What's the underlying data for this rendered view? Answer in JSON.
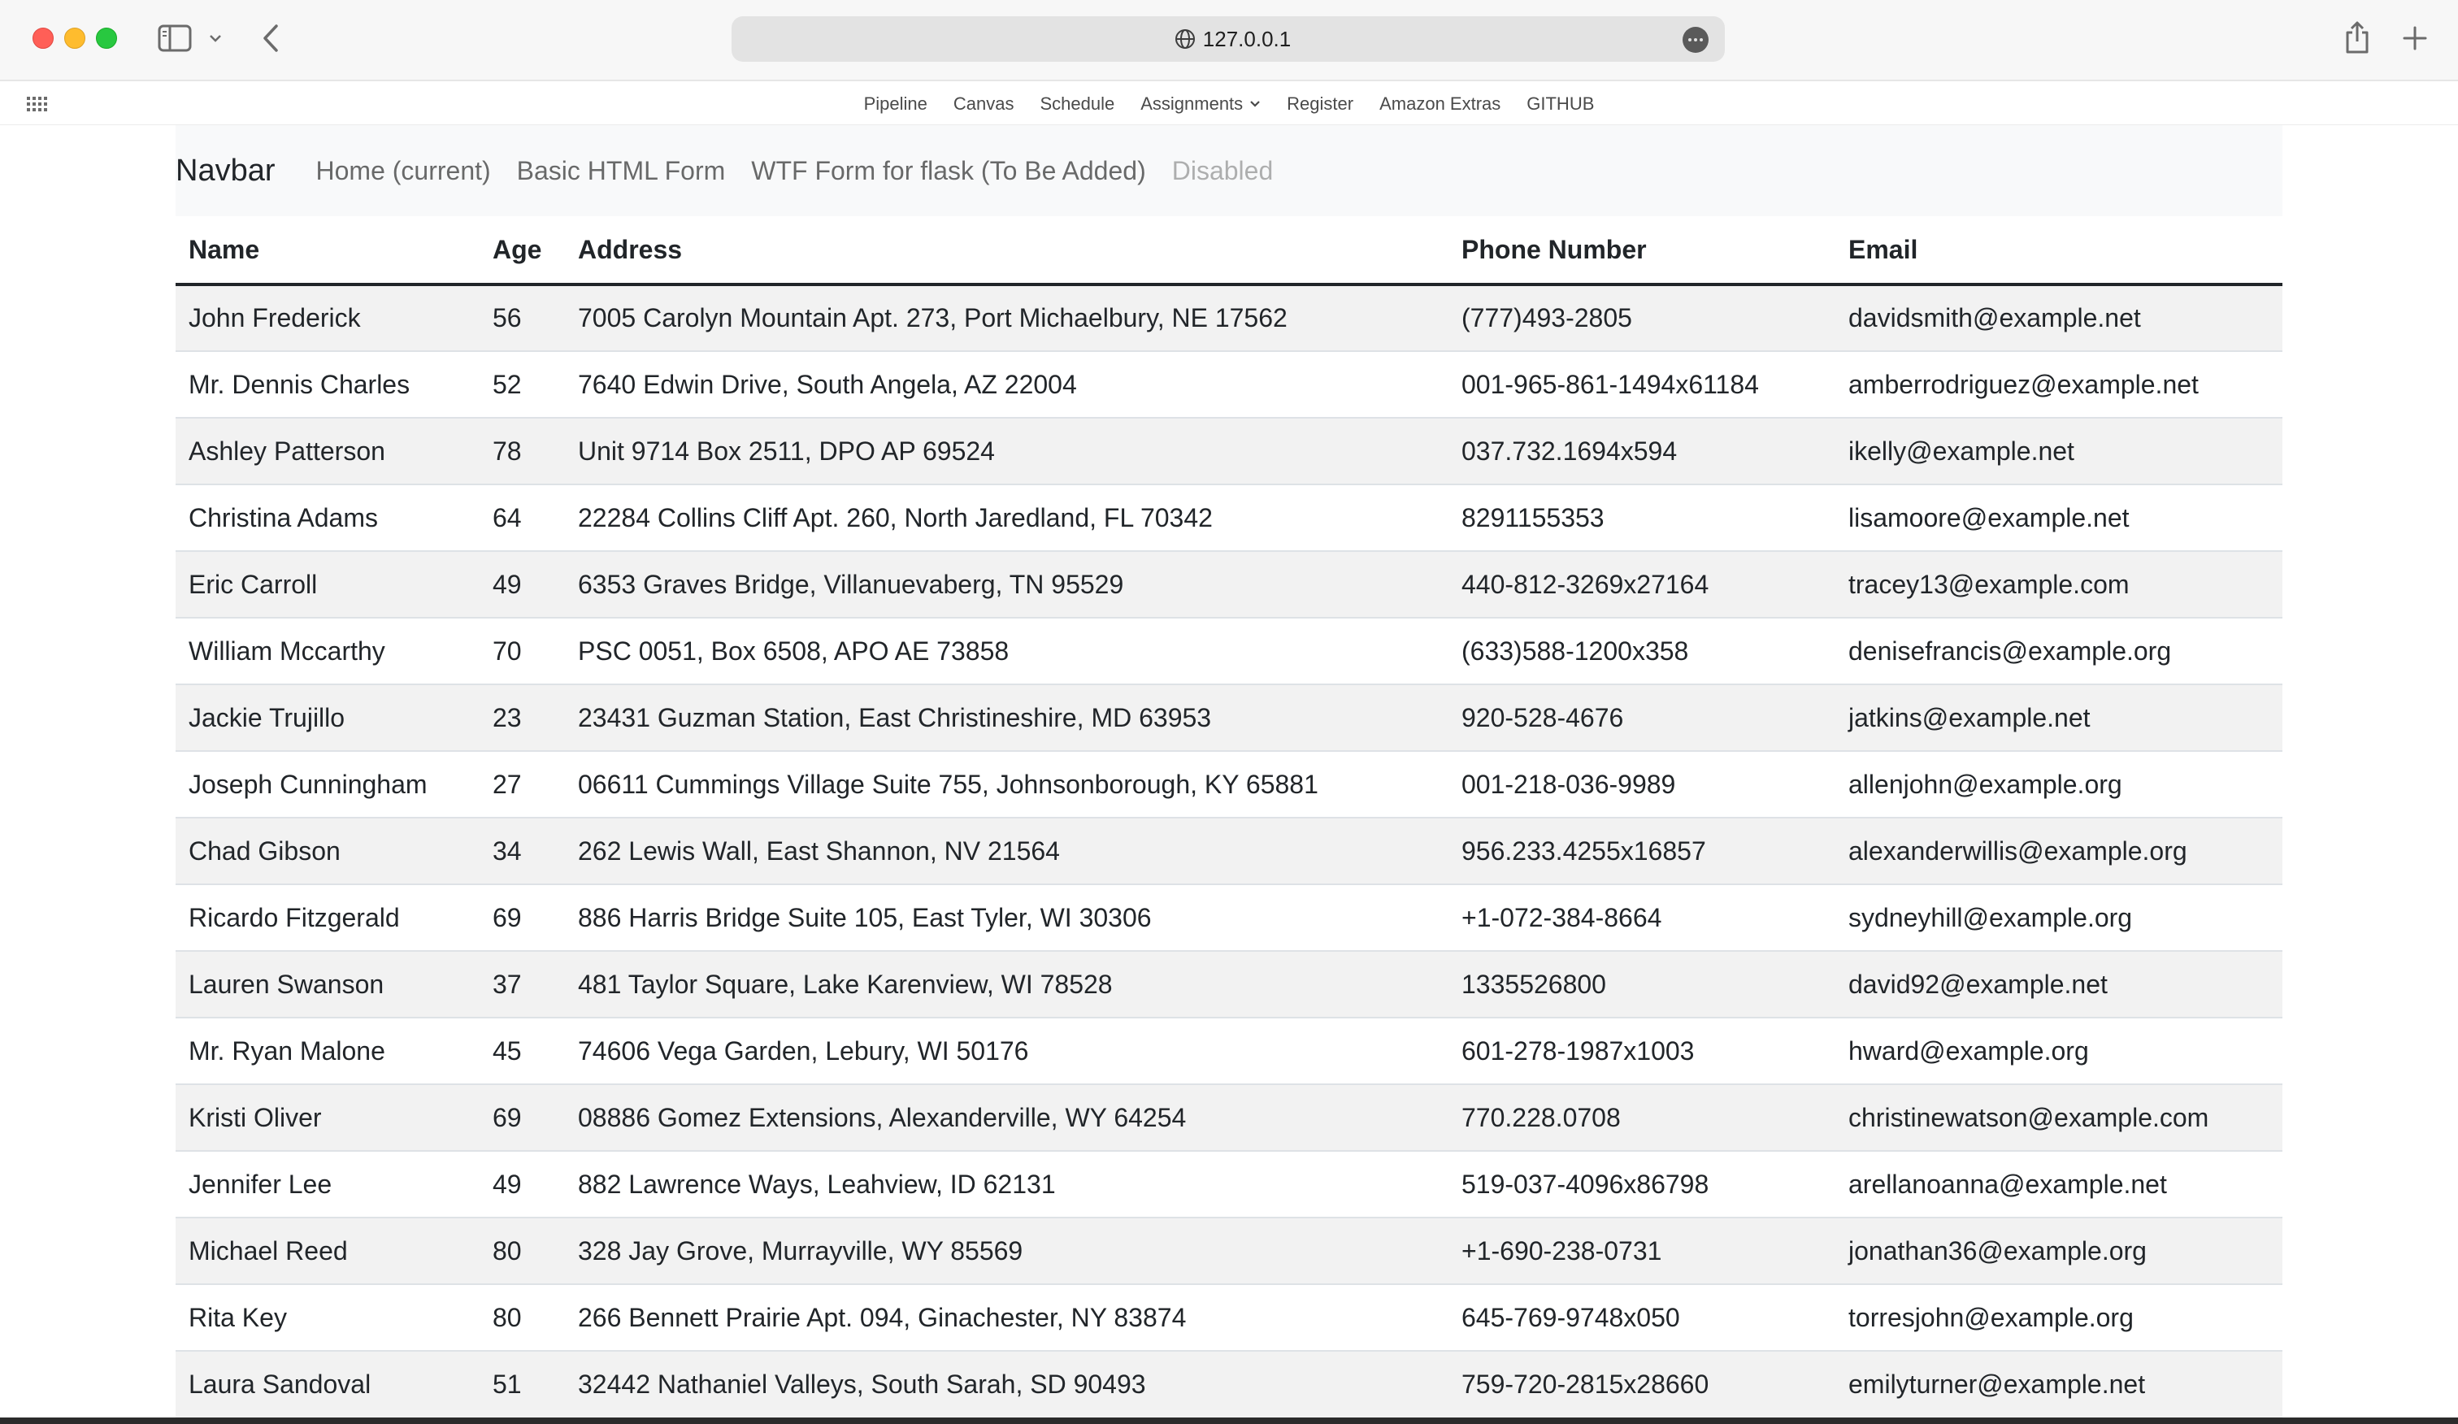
{
  "browser": {
    "url": "127.0.0.1"
  },
  "favorites": [
    {
      "label": "Pipeline"
    },
    {
      "label": "Canvas"
    },
    {
      "label": "Schedule"
    },
    {
      "label": "Assignments"
    },
    {
      "label": "Register"
    },
    {
      "label": "Amazon Extras"
    },
    {
      "label": "GITHUB"
    }
  ],
  "navbar": {
    "brand": "Navbar",
    "links": [
      {
        "label": "Home (current)"
      },
      {
        "label": "Basic HTML Form"
      },
      {
        "label": "WTF Form for flask (To Be Added)"
      },
      {
        "label": "Disabled"
      }
    ]
  },
  "table": {
    "headers": [
      "Name",
      "Age",
      "Address",
      "Phone Number",
      "Email"
    ],
    "rows": [
      [
        "John Frederick",
        "56",
        "7005 Carolyn Mountain Apt. 273, Port Michaelbury, NE 17562",
        "(777)493-2805",
        "davidsmith@example.net"
      ],
      [
        "Mr. Dennis Charles",
        "52",
        "7640 Edwin Drive, South Angela, AZ 22004",
        "001-965-861-1494x61184",
        "amberrodriguez@example.net"
      ],
      [
        "Ashley Patterson",
        "78",
        "Unit 9714 Box 2511, DPO AP 69524",
        "037.732.1694x594",
        "ikelly@example.net"
      ],
      [
        "Christina Adams",
        "64",
        "22284 Collins Cliff Apt. 260, North Jaredland, FL 70342",
        "8291155353",
        "lisamoore@example.net"
      ],
      [
        "Eric Carroll",
        "49",
        "6353 Graves Bridge, Villanuevaberg, TN 95529",
        "440-812-3269x27164",
        "tracey13@example.com"
      ],
      [
        "William Mccarthy",
        "70",
        "PSC 0051, Box 6508, APO AE 73858",
        "(633)588-1200x358",
        "denisefrancis@example.org"
      ],
      [
        "Jackie Trujillo",
        "23",
        "23431 Guzman Station, East Christineshire, MD 63953",
        "920-528-4676",
        "jatkins@example.net"
      ],
      [
        "Joseph Cunningham",
        "27",
        "06611 Cummings Village Suite 755, Johnsonborough, KY 65881",
        "001-218-036-9989",
        "allenjohn@example.org"
      ],
      [
        "Chad Gibson",
        "34",
        "262 Lewis Wall, East Shannon, NV 21564",
        "956.233.4255x16857",
        "alexanderwillis@example.org"
      ],
      [
        "Ricardo Fitzgerald",
        "69",
        "886 Harris Bridge Suite 105, East Tyler, WI 30306",
        "+1-072-384-8664",
        "sydneyhill@example.org"
      ],
      [
        "Lauren Swanson",
        "37",
        "481 Taylor Square, Lake Karenview, WI 78528",
        "1335526800",
        "david92@example.net"
      ],
      [
        "Mr. Ryan Malone",
        "45",
        "74606 Vega Garden, Lebury, WI 50176",
        "601-278-1987x1003",
        "hward@example.org"
      ],
      [
        "Kristi Oliver",
        "69",
        "08886 Gomez Extensions, Alexanderville, WY 64254",
        "770.228.0708",
        "christinewatson@example.com"
      ],
      [
        "Jennifer Lee",
        "49",
        "882 Lawrence Ways, Leahview, ID 62131",
        "519-037-4096x86798",
        "arellanoanna@example.net"
      ],
      [
        "Michael Reed",
        "80",
        "328 Jay Grove, Murrayville, WY 85569",
        "+1-690-238-0731",
        "jonathan36@example.org"
      ],
      [
        "Rita Key",
        "80",
        "266 Bennett Prairie Apt. 094, Ginachester, NY 83874",
        "645-769-9748x050",
        "torresjohn@example.org"
      ],
      [
        "Laura Sandoval",
        "51",
        "32442 Nathaniel Valleys, South Sarah, SD 90493",
        "759-720-2815x28660",
        "emilyturner@example.net"
      ]
    ]
  }
}
